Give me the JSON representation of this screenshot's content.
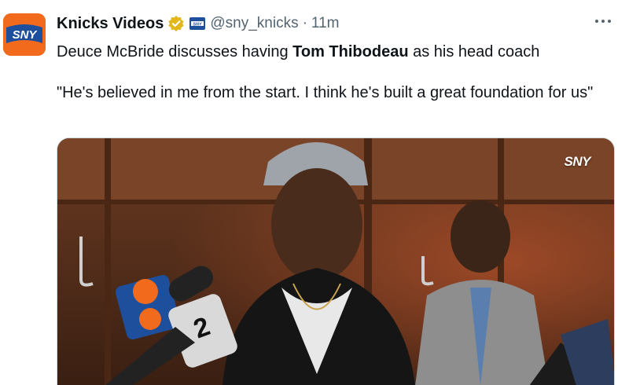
{
  "account": {
    "display_name": "Knicks Videos",
    "handle": "@sny_knicks",
    "separator": "·",
    "time": "11m",
    "avatar_text": "SNY",
    "affiliate_badge": "sny-affiliate-badge",
    "verified_icon": "gold-verified-badge-icon"
  },
  "tweet": {
    "line_prefix": "Deuce McBride discusses having ",
    "line_bold": "Tom Thibodeau",
    "line_suffix": " as his head coach",
    "quote": "\"He's believed in me from the start. I think he's built a great foundation for us\""
  },
  "media": {
    "watermark": "SNY",
    "microphone_logo": "2"
  },
  "icons": {
    "more": "more-options-icon"
  },
  "colors": {
    "handle_gray": "#536471",
    "brand_orange": "#f26b1d",
    "brand_blue": "#1d4f9c",
    "verified_gold": "#e2b719"
  }
}
